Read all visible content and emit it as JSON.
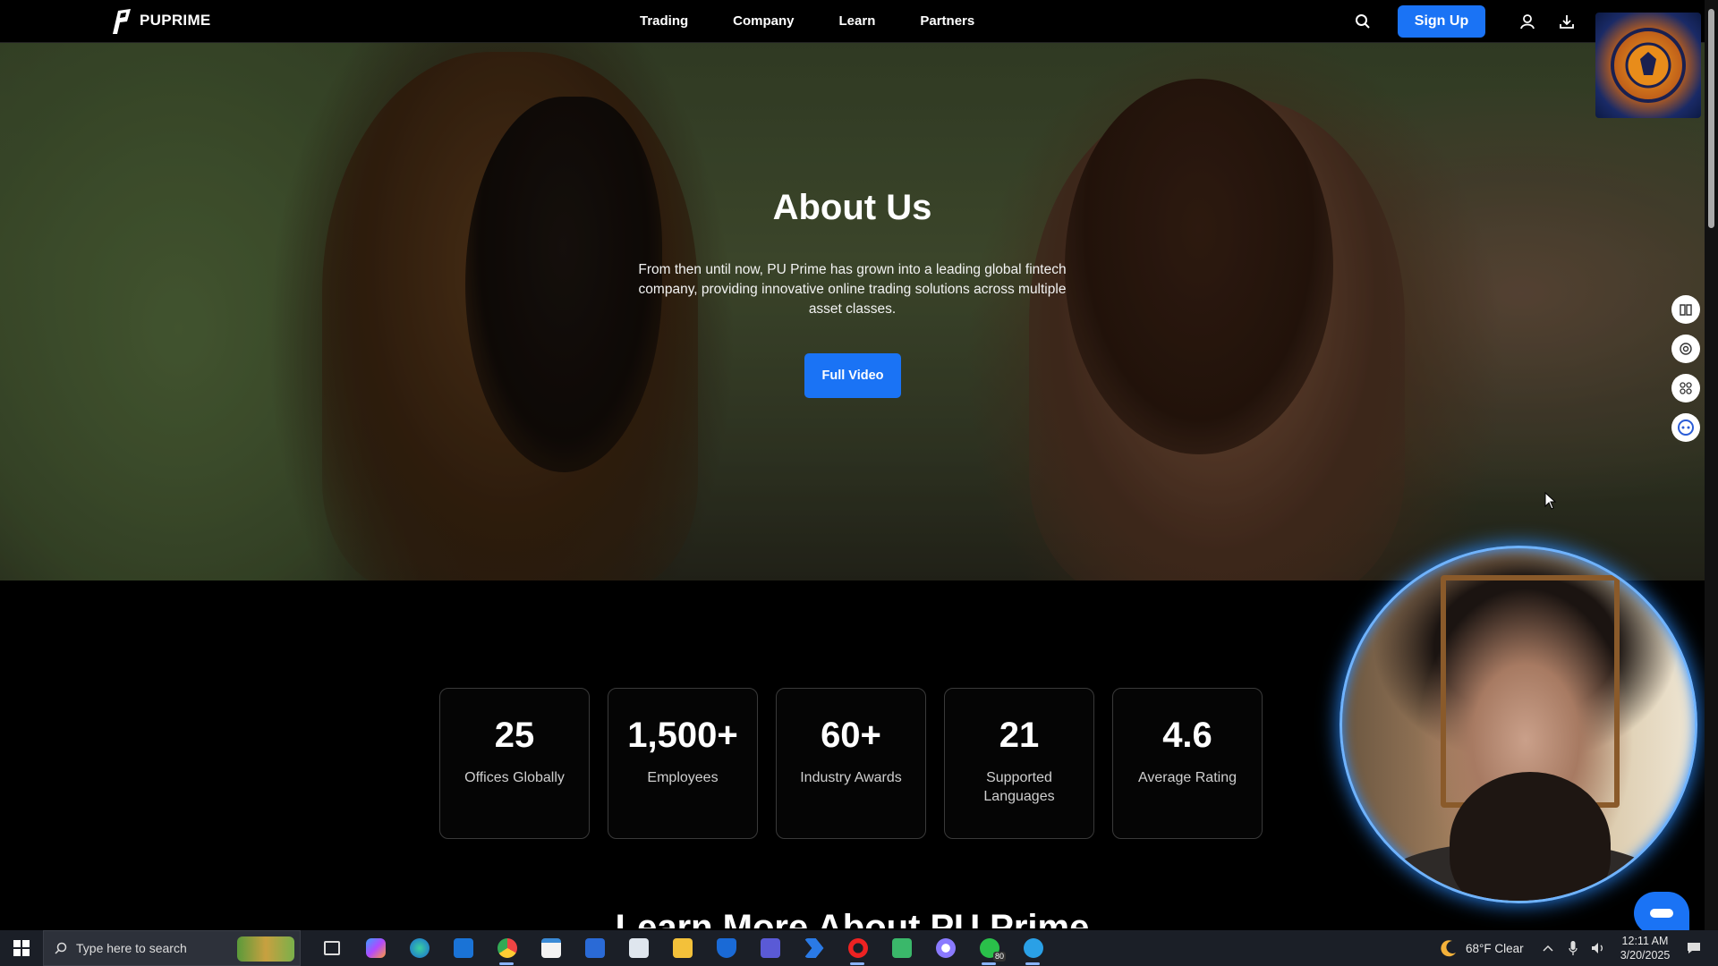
{
  "nav": {
    "brand": "PUPRIME",
    "links": [
      "Trading",
      "Company",
      "Learn",
      "Partners"
    ],
    "signup_label": "Sign Up"
  },
  "hero": {
    "title": "About Us",
    "text": "From then until now, PU Prime has grown into a leading global fintech company, providing innovative online trading solutions across multiple asset classes.",
    "video_button": "Full Video"
  },
  "stats": [
    {
      "value": "25",
      "label": "Offices Globally"
    },
    {
      "value": "1,500+",
      "label": "Employees"
    },
    {
      "value": "60+",
      "label": "Industry Awards"
    },
    {
      "value": "21",
      "label": "Supported Languages"
    },
    {
      "value": "4.6",
      "label": "Average Rating"
    }
  ],
  "next_section_title": "Learn More About PU Prime",
  "float_icons": [
    "book-icon",
    "target-icon",
    "apps-icon",
    "chat-bot-icon"
  ],
  "taskbar": {
    "search_placeholder": "Type here to search",
    "whatsapp_badge": "80",
    "weather": "68°F  Clear",
    "time": "12:11 AM",
    "date": "3/20/2025"
  },
  "colors": {
    "accent": "#1a73f5",
    "background": "#000000",
    "taskbar": "#1b1f27"
  }
}
